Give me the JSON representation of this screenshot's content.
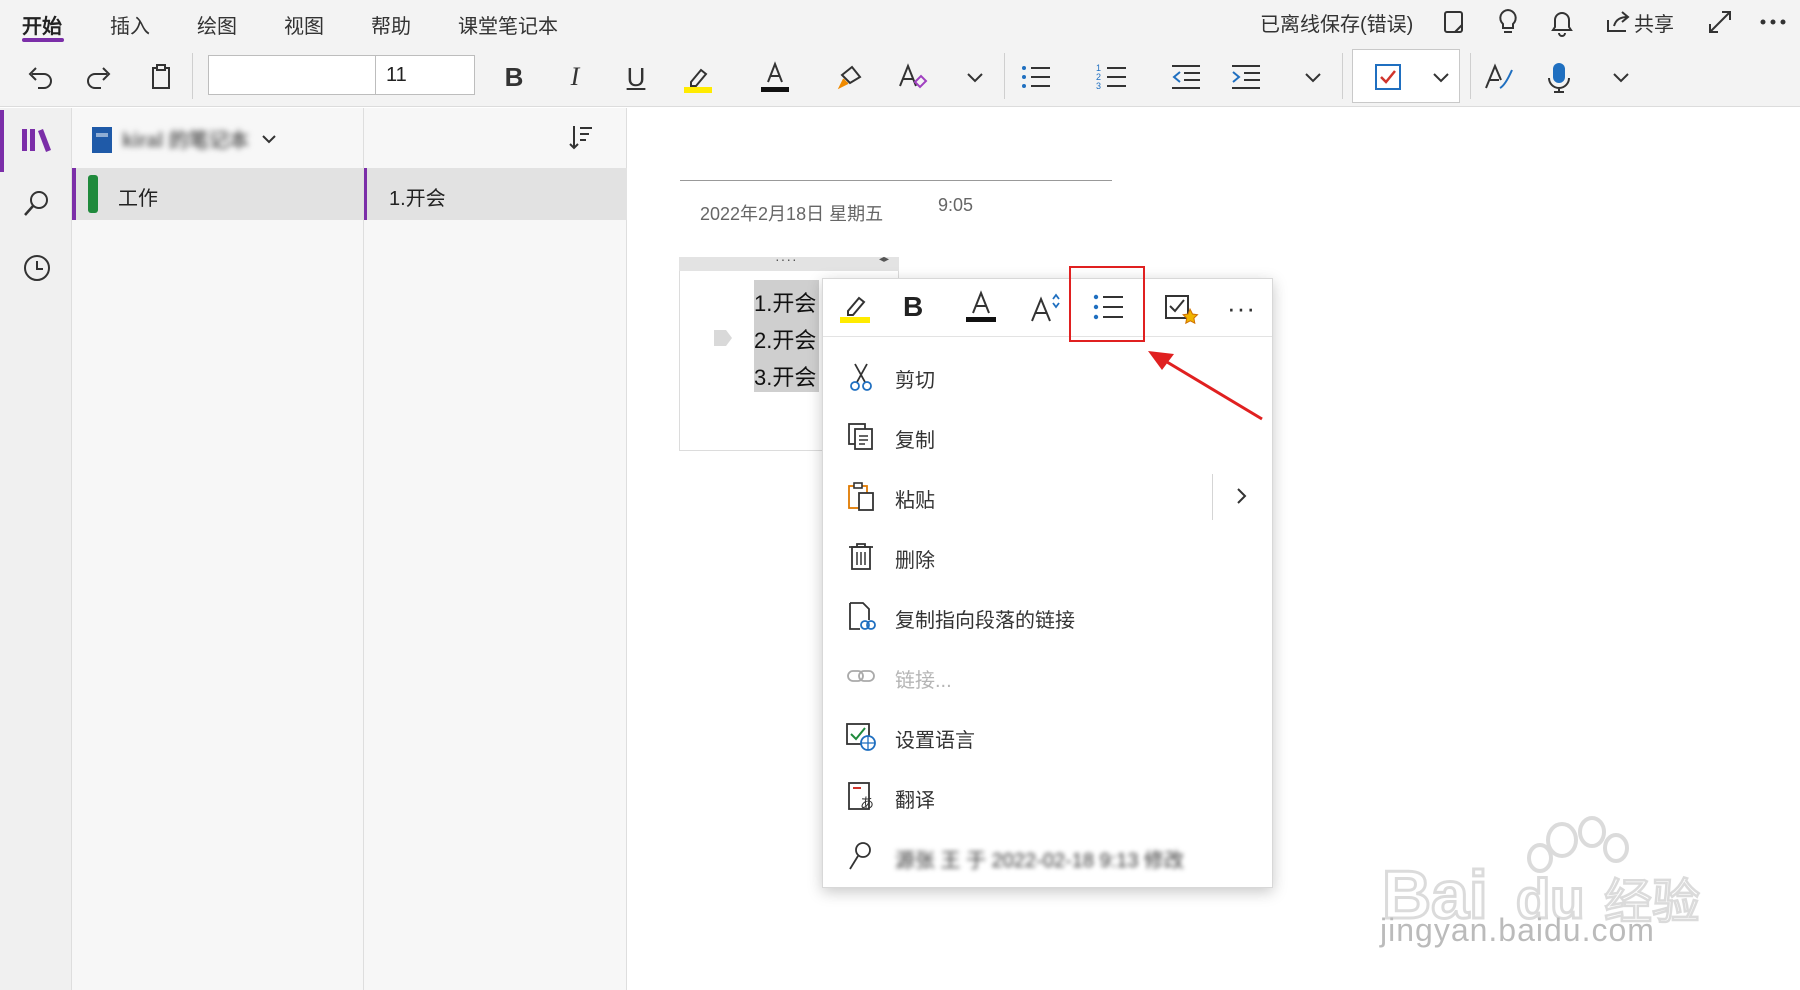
{
  "tabs": [
    {
      "label": "开始",
      "active": true
    },
    {
      "label": "插入"
    },
    {
      "label": "绘图"
    },
    {
      "label": "视图"
    },
    {
      "label": "帮助"
    },
    {
      "label": "课堂笔记本"
    }
  ],
  "status_text": "已离线保存(错误)",
  "share_label": "共享",
  "ribbon": {
    "font_name_value": "",
    "font_size_value": "11",
    "colors": {
      "highlight": "#ffeb00",
      "font": "#111111",
      "accent": "#7b2ea8"
    }
  },
  "notebook": {
    "name": "kiral 的笔记本"
  },
  "sections": [
    {
      "label": "工作",
      "color": "#1f8a3c"
    }
  ],
  "pages": [
    {
      "label": "1.开会"
    }
  ],
  "page": {
    "date": "2022年2月18日 星期五",
    "time": "9:05",
    "lines": [
      "1.开会",
      "2.开会",
      "3.开会"
    ]
  },
  "context_menu": {
    "toolbar_icons": [
      "highlight-icon",
      "bold-icon",
      "font-color-icon",
      "font-size-icon",
      "bullet-list-icon",
      "tag-icon",
      "more-icon"
    ],
    "items": [
      {
        "label": "剪切",
        "icon": "scissors-icon",
        "enabled": true
      },
      {
        "label": "复制",
        "icon": "copy-icon",
        "enabled": true
      },
      {
        "label": "粘贴",
        "icon": "paste-icon",
        "enabled": true,
        "submenu": true
      },
      {
        "label": "删除",
        "icon": "trash-icon",
        "enabled": true
      },
      {
        "label": "复制指向段落的链接",
        "icon": "link-doc-icon",
        "enabled": true
      },
      {
        "label": "链接...",
        "icon": "link-icon",
        "enabled": false
      },
      {
        "label": "设置语言",
        "icon": "language-icon",
        "enabled": true
      },
      {
        "label": "翻译",
        "icon": "translate-icon",
        "enabled": true
      },
      {
        "label": "源张 王 于 2022-02-18 9:13 修改",
        "icon": "person-icon",
        "enabled": true
      }
    ]
  },
  "watermark": {
    "text": "Baidu经验",
    "url": "jingyan.baidu.com"
  }
}
